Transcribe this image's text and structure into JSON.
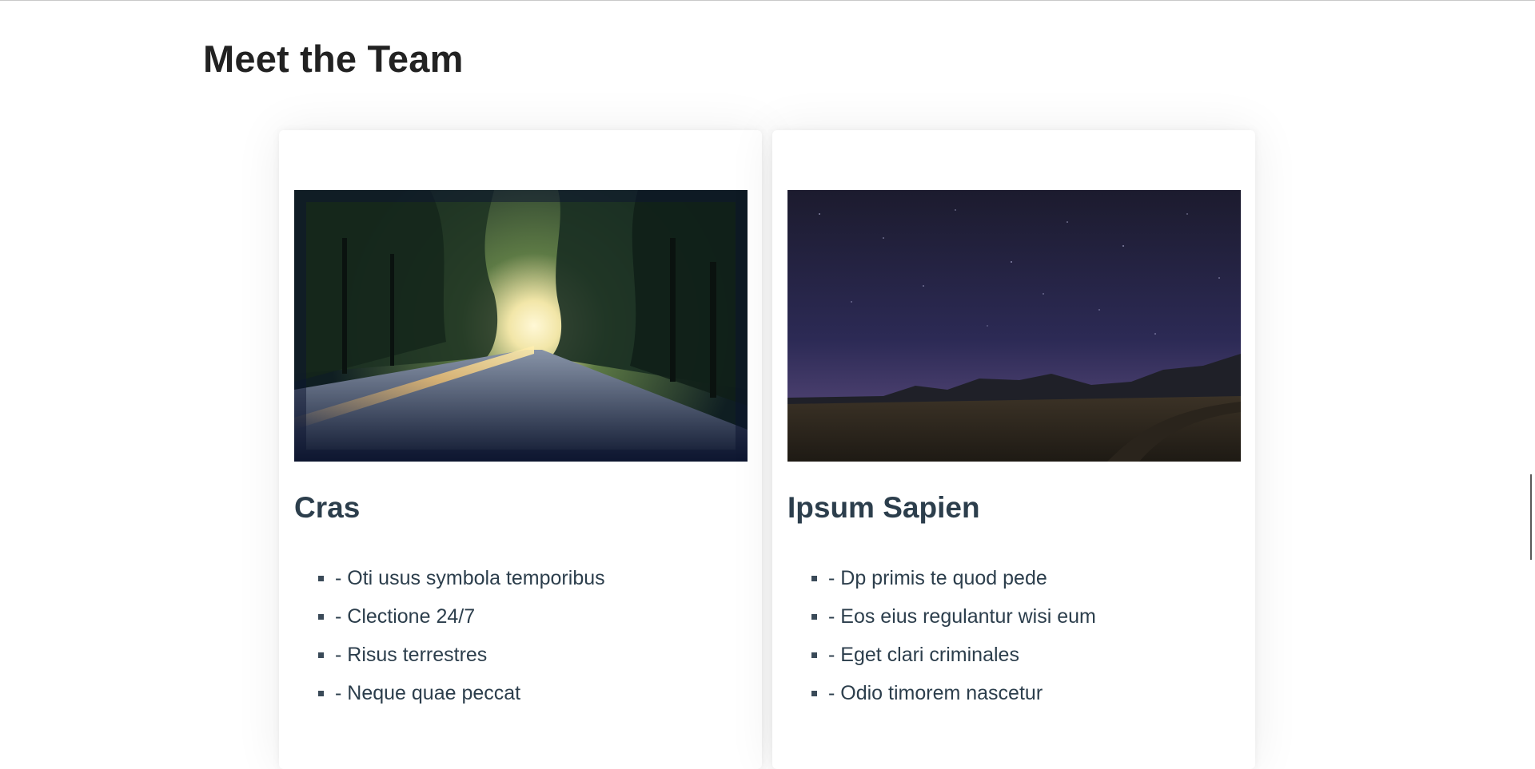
{
  "section": {
    "title": "Meet the Team"
  },
  "cards": [
    {
      "image": "road-forest-sunrise-photo",
      "name": "Cras",
      "features": [
        "- Oti usus symbola temporibus",
        "- Clectione 24/7",
        "- Risus terrestres",
        "- Neque quae peccat"
      ]
    },
    {
      "image": "night-sky-field-photo",
      "name": "Ipsum Sapien",
      "features": [
        "- Dp primis te quod pede",
        "- Eos eius regulantur wisi eum",
        "- Eget clari criminales",
        "- Odio timorem nascetur"
      ]
    }
  ],
  "colors": {
    "heading": "#222222",
    "card_text": "#2c3e4c",
    "bullet": "#3a4a58"
  }
}
